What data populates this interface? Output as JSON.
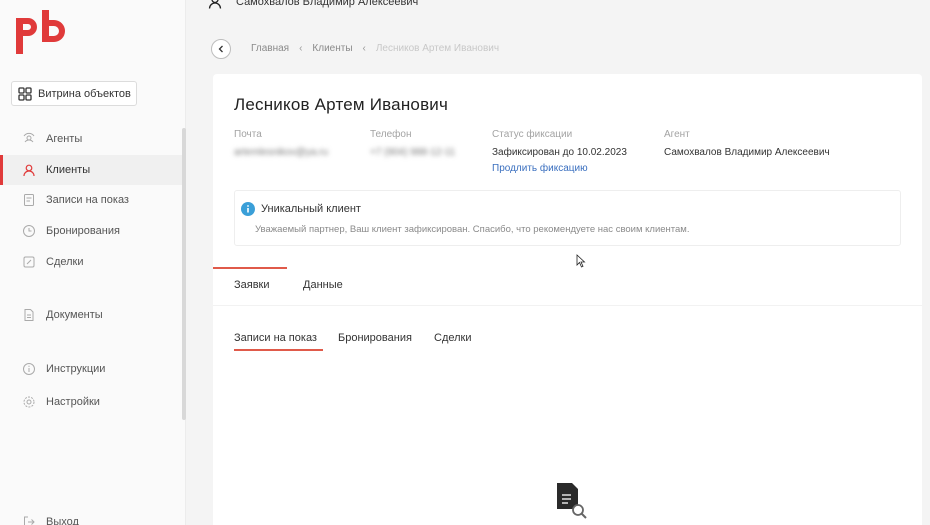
{
  "brand": {
    "logo_text": "pb",
    "accent": "#e03a3a"
  },
  "top_user": {
    "name": "Самохвалов Владимир Алексеевич",
    "icon": "user-icon"
  },
  "sidebar": {
    "vitrina": {
      "label": "Витрина объектов",
      "icon": "grid-icon"
    },
    "items": [
      {
        "label": "Агенты",
        "icon": "agents-icon"
      },
      {
        "label": "Клиенты",
        "icon": "user-icon",
        "active": true
      },
      {
        "label": "Записи на показ",
        "icon": "notes-icon"
      },
      {
        "label": "Бронирования",
        "icon": "booking-icon"
      },
      {
        "label": "Сделки",
        "icon": "deals-icon"
      },
      {
        "label": "Документы",
        "icon": "document-icon"
      },
      {
        "label": "Инструкции",
        "icon": "info-icon"
      },
      {
        "label": "Настройки",
        "icon": "gear-icon"
      },
      {
        "label": "Выход",
        "icon": "logout-icon"
      }
    ]
  },
  "breadcrumb": {
    "items": [
      "Главная",
      "Клиенты",
      "Лесников Артем Иванович"
    ]
  },
  "client": {
    "name": "Лесников Артем Иванович",
    "fields": {
      "email": {
        "label": "Почта",
        "value": "artemlesnikov@ya.ru"
      },
      "phone": {
        "label": "Телефон",
        "value": "+7 (904) 988-12-11"
      },
      "status": {
        "label": "Статус фиксации",
        "value": "Зафиксирован до 10.02.2023",
        "link": "Продлить фиксацию"
      },
      "agent": {
        "label": "Агент",
        "value": "Самохвалов Владимир Алексеевич"
      }
    }
  },
  "notice": {
    "title": "Уникальный клиент",
    "text": "Уважаемый партнер, Ваш клиент зафиксирован. Спасибо, что рекомендуете нас своим клиентам."
  },
  "tabs": [
    "Заявки",
    "Данные"
  ],
  "subtabs": [
    "Записи на показ",
    "Бронирования",
    "Сделки"
  ]
}
